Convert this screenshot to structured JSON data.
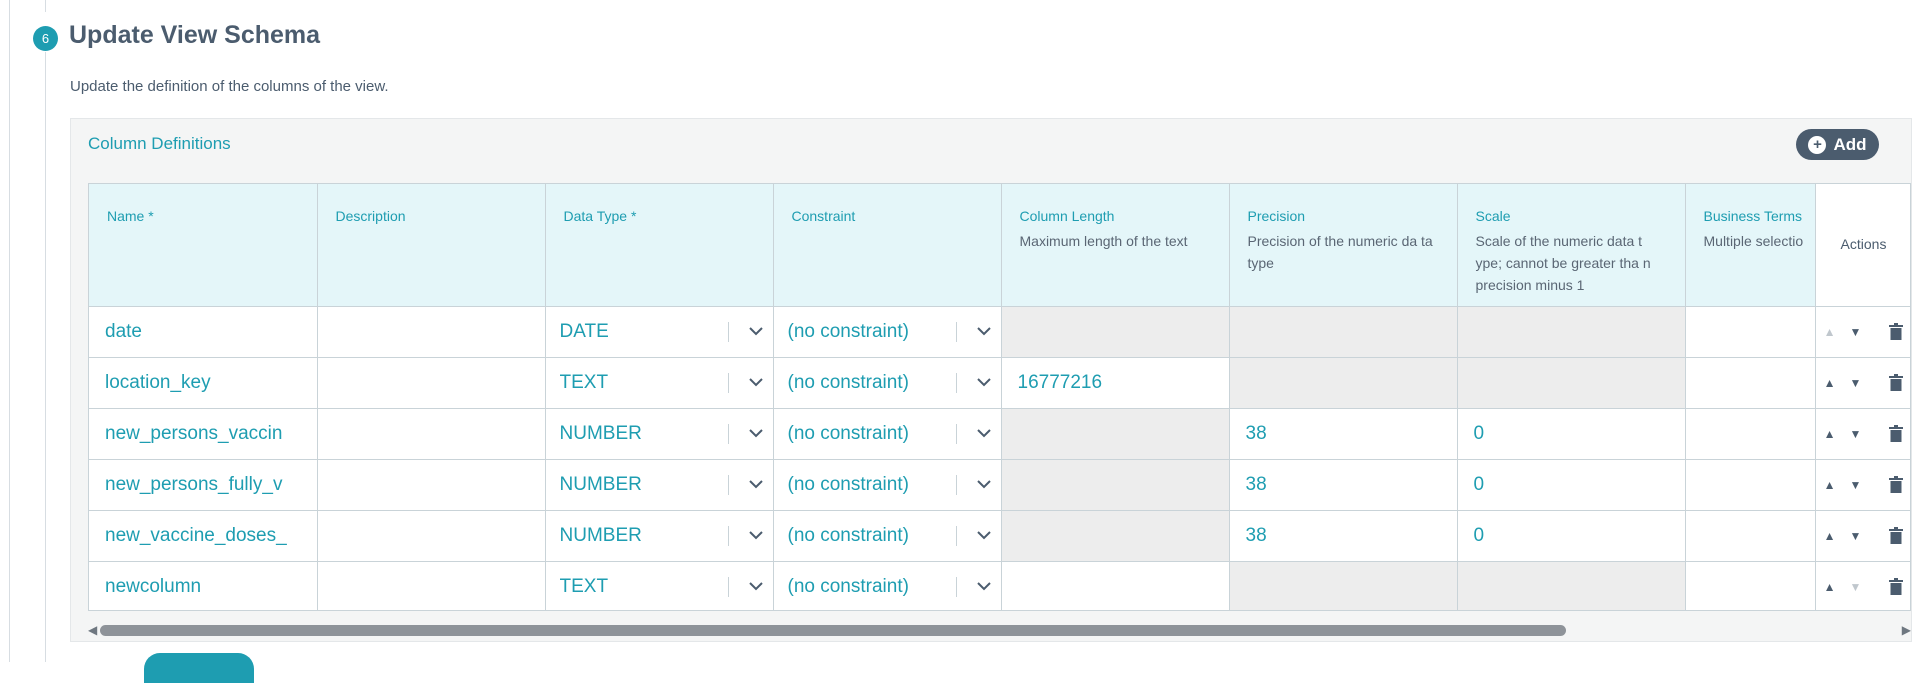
{
  "step": {
    "number": "6",
    "title": "Update View Schema",
    "description": "Update the definition of the columns of the view."
  },
  "panel": {
    "title": "Column Definitions",
    "add_label": "Add"
  },
  "columns": {
    "name": {
      "title": "Name *",
      "sub": ""
    },
    "description": {
      "title": "Description",
      "sub": ""
    },
    "data_type": {
      "title": "Data Type *",
      "sub": ""
    },
    "constraint": {
      "title": "Constraint",
      "sub": ""
    },
    "column_length": {
      "title": "Column Length",
      "sub": "Maximum length of the text"
    },
    "precision": {
      "title": "Precision",
      "sub": "Precision of the numeric da ta type"
    },
    "scale": {
      "title": "Scale",
      "sub": "Scale of the numeric data t ype; cannot be greater tha n precision minus 1"
    },
    "business_terms": {
      "title": "Business Terms",
      "sub": "Multiple selectio"
    },
    "actions": {
      "title": "Actions"
    }
  },
  "rows": [
    {
      "name": "date",
      "description": "",
      "data_type": "DATE",
      "constraint": "(no constraint)",
      "length": "",
      "precision": "",
      "scale": ""
    },
    {
      "name": "location_key",
      "description": "",
      "data_type": "TEXT",
      "constraint": "(no constraint)",
      "length": "16777216",
      "precision": "",
      "scale": ""
    },
    {
      "name": "new_persons_vaccin",
      "description": "",
      "data_type": "NUMBER",
      "constraint": "(no constraint)",
      "length": "",
      "precision": "38",
      "scale": "0"
    },
    {
      "name": "new_persons_fully_v",
      "description": "",
      "data_type": "NUMBER",
      "constraint": "(no constraint)",
      "length": "",
      "precision": "38",
      "scale": "0"
    },
    {
      "name": "new_vaccine_doses_",
      "description": "",
      "data_type": "NUMBER",
      "constraint": "(no constraint)",
      "length": "",
      "precision": "38",
      "scale": "0"
    },
    {
      "name": "newcolumn",
      "description": "",
      "data_type": "TEXT",
      "constraint": "(no constraint)",
      "length": "",
      "precision": "",
      "scale": ""
    }
  ],
  "icons": {
    "add": "plus-circle-icon",
    "move_up": "caret-up-icon",
    "move_down": "caret-down-icon",
    "delete": "trash-icon",
    "dropdown": "chevron-down-icon"
  },
  "colors": {
    "accent": "#1e9db1",
    "dark": "#4b5c6e",
    "header_bg": "#e4f6f9",
    "disabled_bg": "#ededed"
  }
}
